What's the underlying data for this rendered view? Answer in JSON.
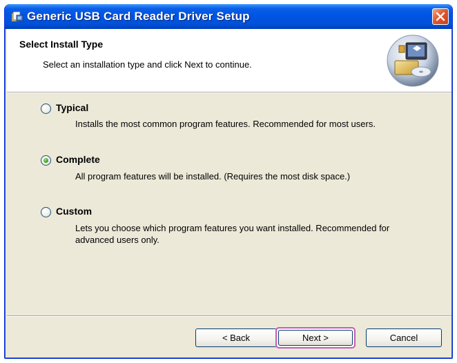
{
  "window": {
    "title": "Generic USB Card Reader Driver Setup"
  },
  "header": {
    "title": "Select Install Type",
    "subtitle": "Select an installation type and click Next to continue."
  },
  "options": [
    {
      "label": "Typical",
      "description": "Installs the most common program features. Recommended for most users.",
      "checked": false
    },
    {
      "label": "Complete",
      "description": "All program features will be installed. (Requires the most disk space.)",
      "checked": true
    },
    {
      "label": "Custom",
      "description": "Lets you choose which program features you want installed. Recommended for advanced users only.",
      "checked": false
    }
  ],
  "buttons": {
    "back": "< Back",
    "next": "Next >",
    "cancel": "Cancel"
  },
  "colors": {
    "titlebar": "#0054e3",
    "highlight": "#c45bb6",
    "face": "#ece9d8"
  },
  "icons": {
    "app": "setup-app-icon",
    "close": "close-icon",
    "header": "computer-disc-icon"
  }
}
